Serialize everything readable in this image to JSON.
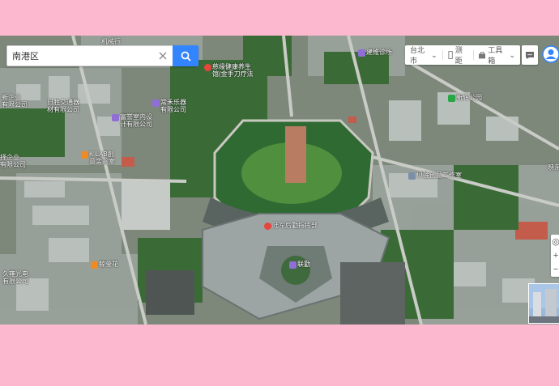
{
  "search": {
    "value": "南港区"
  },
  "toolbar": {
    "city": "台北市",
    "ranging_label": "测距",
    "tools_label": "工具箱"
  },
  "map_labels": [
    {
      "id": "label-top-trade",
      "text": "机械行",
      "icon": ""
    },
    {
      "id": "label-health-knife",
      "text": "慈缘健康养生\n馆(金手刀疗法",
      "icon": "red"
    },
    {
      "id": "label-jianwei-clinic",
      "text": "建维诊所",
      "icon": "purple"
    },
    {
      "id": "label-enterprise-left",
      "text": "新企业\n有限公司",
      "icon": ""
    },
    {
      "id": "label-risheng-trading",
      "text": "日胜交通器\n材有限公司",
      "icon": ""
    },
    {
      "id": "label-changhe-music",
      "text": "常禾乐器\n有限公司",
      "icon": "purple"
    },
    {
      "id": "label-fuyu-design",
      "text": "富誉室内设\n计有限公司",
      "icon": "purple"
    },
    {
      "id": "label-xinhui-park",
      "text": "新辉公园",
      "icon": "green"
    },
    {
      "id": "label-klab",
      "text": "K LAB創\n意实验室",
      "icon": "orange"
    },
    {
      "id": "label-enterprise-left-2",
      "text": "择企业\n有限公司",
      "icon": ""
    },
    {
      "id": "label-beilian-studio",
      "text": "贝莲创意工作室",
      "icon": "gray"
    },
    {
      "id": "label-east-right",
      "text": "映东",
      "icon": ""
    },
    {
      "id": "label-army-logistics",
      "text": "陆军后勤指挥部",
      "icon": "red"
    },
    {
      "id": "label-jinyinghua",
      "text": "鲸瑩花",
      "icon": "orange"
    },
    {
      "id": "label-lianqin",
      "text": "联勤",
      "icon": "purple"
    },
    {
      "id": "label-jiuyong-light",
      "text": "久雍光电\n有限公司",
      "icon": ""
    }
  ]
}
